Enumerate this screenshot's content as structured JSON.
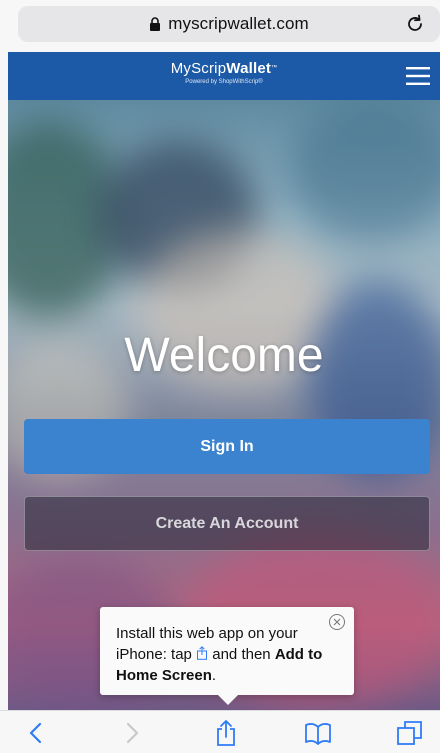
{
  "browser": {
    "url": "myscripwallet.com",
    "icons": [
      "lock-icon",
      "reload-icon"
    ]
  },
  "header": {
    "logo_light": "MyScrip",
    "logo_bold": "Wallet",
    "logo_mark": "™",
    "logo_sub": "Powered by ShopWithScrip®",
    "menu_icon": "hamburger-menu-icon"
  },
  "hero": {
    "title": "Welcome",
    "signin_label": "Sign In",
    "create_label": "Create An Account"
  },
  "install_popup": {
    "text_before": "Install this web app on your iPhone: tap",
    "text_middle": "and then",
    "bold_text": "Add to Home Screen",
    "text_end": ".",
    "icons": [
      "share-icon",
      "close-icon"
    ]
  },
  "toolbar": {
    "icons": [
      "back-icon",
      "forward-icon",
      "share-icon",
      "bookmarks-icon",
      "tabs-icon"
    ]
  },
  "colors": {
    "header_blue": "#1c5aa8",
    "signin_blue": "#3b82cf",
    "ios_blue": "#2f7cf6"
  }
}
